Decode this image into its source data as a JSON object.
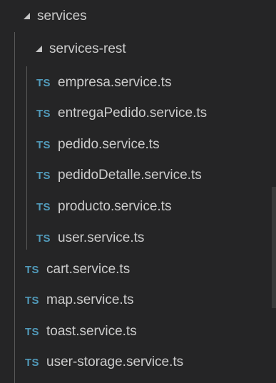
{
  "tree": {
    "folder_services": {
      "label": "services",
      "icon": "chevron-down-icon"
    },
    "folder_services_rest": {
      "label": "services-rest",
      "icon": "chevron-down-icon"
    },
    "file_icon_text": "TS",
    "nested_files": [
      {
        "label": "empresa.service.ts"
      },
      {
        "label": "entregaPedido.service.ts"
      },
      {
        "label": "pedido.service.ts"
      },
      {
        "label": "pedidoDetalle.service.ts"
      },
      {
        "label": "producto.service.ts"
      },
      {
        "label": "user.service.ts"
      }
    ],
    "files": [
      {
        "label": "cart.service.ts"
      },
      {
        "label": "map.service.ts"
      },
      {
        "label": "toast.service.ts"
      },
      {
        "label": "user-storage.service.ts"
      }
    ]
  },
  "colors": {
    "background": "#252526",
    "text": "#cccccc",
    "ts_icon": "#519aba",
    "indent_guide": "#585858"
  }
}
